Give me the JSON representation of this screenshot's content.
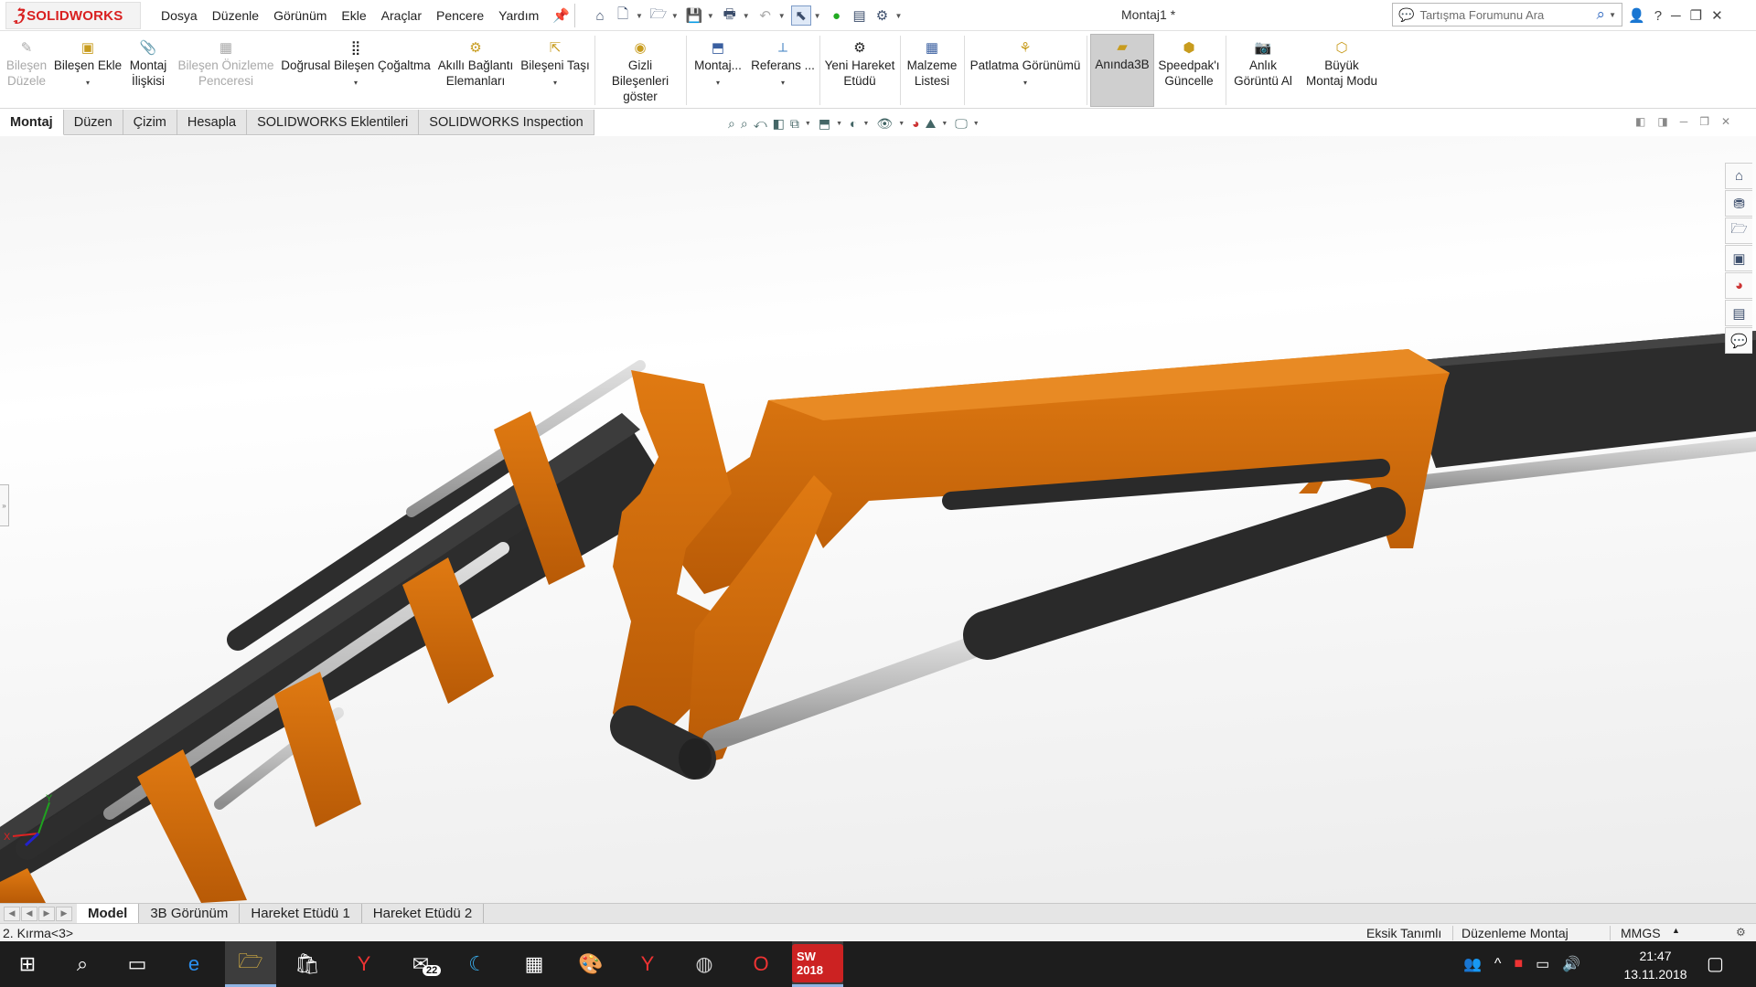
{
  "app": {
    "brand": "SOLIDWORKS",
    "doc_title": "Montaj1 *"
  },
  "menu": [
    "Dosya",
    "Düzenle",
    "Görünüm",
    "Ekle",
    "Araçlar",
    "Pencere",
    "Yardım"
  ],
  "search": {
    "placeholder": "Tartışma Forumunu Ara"
  },
  "ribbon": {
    "buttons": [
      {
        "l1": "Bileşen",
        "l2": "Düzele",
        "disabled": true
      },
      {
        "l1": "Bileşen Ekle",
        "l2": ""
      },
      {
        "l1": "Montaj",
        "l2": "İlişkisi"
      },
      {
        "l1": "Bileşen Önizleme",
        "l2": "Penceresi",
        "disabled": true
      },
      {
        "l1": "Doğrusal Bileşen Çoğaltma",
        "l2": ""
      },
      {
        "l1": "Akıllı Bağlantı",
        "l2": "Elemanları"
      },
      {
        "l1": "Bileşeni Taşı",
        "l2": ""
      },
      {
        "l1": "Gizli Bileşenleri",
        "l2": "göster"
      },
      {
        "l1": "Montaj...",
        "l2": ""
      },
      {
        "l1": "Referans ...",
        "l2": ""
      },
      {
        "l1": "Yeni Hareket",
        "l2": "Etüdü"
      },
      {
        "l1": "Malzeme",
        "l2": "Listesi"
      },
      {
        "l1": "Patlatma Görünümü",
        "l2": ""
      },
      {
        "l1": "Anında3B",
        "l2": "",
        "active": true
      },
      {
        "l1": "Speedpak'ı",
        "l2": "Güncelle"
      },
      {
        "l1": "Anlık",
        "l2": "Görüntü Al"
      },
      {
        "l1": "Büyük",
        "l2": "Montaj Modu"
      }
    ]
  },
  "command_tabs": [
    "Montaj",
    "Düzen",
    "Çizim",
    "Hesapla",
    "SOLIDWORKS Eklentileri",
    "SOLIDWORKS Inspection"
  ],
  "bottom_tabs": [
    "Model",
    "3B Görünüm",
    "Hareket Etüdü 1",
    "Hareket Etüdü 2"
  ],
  "status": {
    "selection": "2. Kırma<3>",
    "definition": "Eksik Tanımlı",
    "mode": "Düzenleme Montaj",
    "units": "MMGS"
  },
  "triad": {
    "x": "X",
    "y": "Y"
  },
  "taskbar": {
    "mail_badge": "22",
    "time": "21:47",
    "date": "13.11.2018",
    "sw_label": "SW 2018"
  },
  "colors": {
    "orange": "#c0650a",
    "dark": "#2f2f2f",
    "rod": "#b9b9b9",
    "accent": "#d92020"
  }
}
